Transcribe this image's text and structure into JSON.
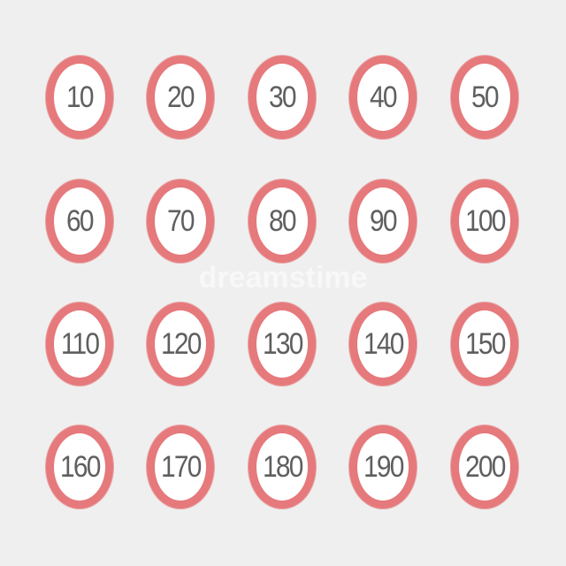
{
  "signs": [
    {
      "label": "10"
    },
    {
      "label": "20"
    },
    {
      "label": "30"
    },
    {
      "label": "40"
    },
    {
      "label": "50"
    },
    {
      "label": "60"
    },
    {
      "label": "70"
    },
    {
      "label": "80"
    },
    {
      "label": "90"
    },
    {
      "label": "100"
    },
    {
      "label": "110"
    },
    {
      "label": "120"
    },
    {
      "label": "130"
    },
    {
      "label": "140"
    },
    {
      "label": "150"
    },
    {
      "label": "160"
    },
    {
      "label": "170"
    },
    {
      "label": "180"
    },
    {
      "label": "190"
    },
    {
      "label": "200"
    }
  ],
  "watermark": "dreamstime",
  "colors": {
    "background": "#efefef",
    "ring": "#e5797b",
    "fill": "#ffffff",
    "text": "#5f5f5f"
  }
}
